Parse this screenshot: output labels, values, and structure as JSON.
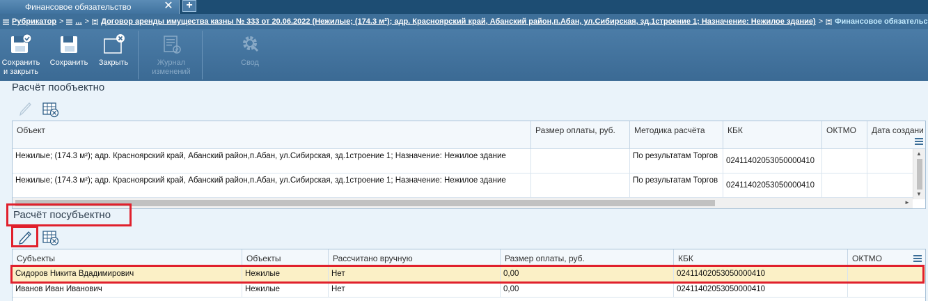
{
  "tab": {
    "title": "Финансовое обязательство",
    "close": "✕",
    "add": "+"
  },
  "breadcrumbs": {
    "root": "Рубрикатор",
    "ellipsis": "...",
    "contract": "Договор аренды имущества казны № 333 от 20.06.2022 (Нежилые; (174.3 м²); адр. Красноярский край, Абанский район,п.Абан, ул.Сибирская, зд.1строение 1; Назначение: Нежилое здание)",
    "current": "Финансовое обязательство",
    "separator": ">"
  },
  "toolbar": {
    "save_close": "Сохранить и закрыть",
    "save_close_line1": "Сохранить",
    "save_close_line2": "и закрыть",
    "save": "Сохранить",
    "close": "Закрыть",
    "journal_line1": "Журнал",
    "journal_line2": "изменений",
    "summary": "Свод"
  },
  "section_objects": {
    "title": "Расчёт пообъектно",
    "columns": [
      "Объект",
      "Размер оплаты, руб.",
      "Методика расчёта",
      "КБК",
      "ОКТМО",
      "Дата создани"
    ],
    "rows": [
      {
        "object": "Нежилые; (174.3 м²); адр. Красноярский край, Абанский район,п.Абан, ул.Сибирская, зд.1строение 1; Назначение: Нежилое здание",
        "amount": "",
        "method": "По результатам Торгов",
        "kbk": "02411402053050000410",
        "oktmo": "",
        "date": ""
      },
      {
        "object": "Нежилые; (174.3 м²); адр. Красноярский край, Абанский район,п.Абан, ул.Сибирская, зд.1строение 1; Назначение: Нежилое здание",
        "amount": "",
        "method": "По результатам Торгов",
        "kbk": "02411402053050000410",
        "oktmo": "",
        "date": ""
      }
    ]
  },
  "section_subjects": {
    "title": "Расчёт посубъектно",
    "columns": [
      "Субъекты",
      "Объекты",
      "Рассчитано вручную",
      "Размер оплаты, руб.",
      "КБК",
      "ОКТМО"
    ],
    "rows": [
      {
        "subject": "Сидоров Никита Вдадимирович",
        "objects": "Нежилые",
        "manual": "Нет",
        "amount": "0,00",
        "kbk": "02411402053050000410",
        "oktmo": ""
      },
      {
        "subject": "Иванов Иван Иванович",
        "objects": "Нежилые",
        "manual": "Нет",
        "amount": "0,00",
        "kbk": "02411402053050000410",
        "oktmo": ""
      }
    ]
  },
  "colors": {
    "accent": "#3e6f99",
    "highlight": "#e0202c",
    "selected_row": "#fbf0c6"
  }
}
